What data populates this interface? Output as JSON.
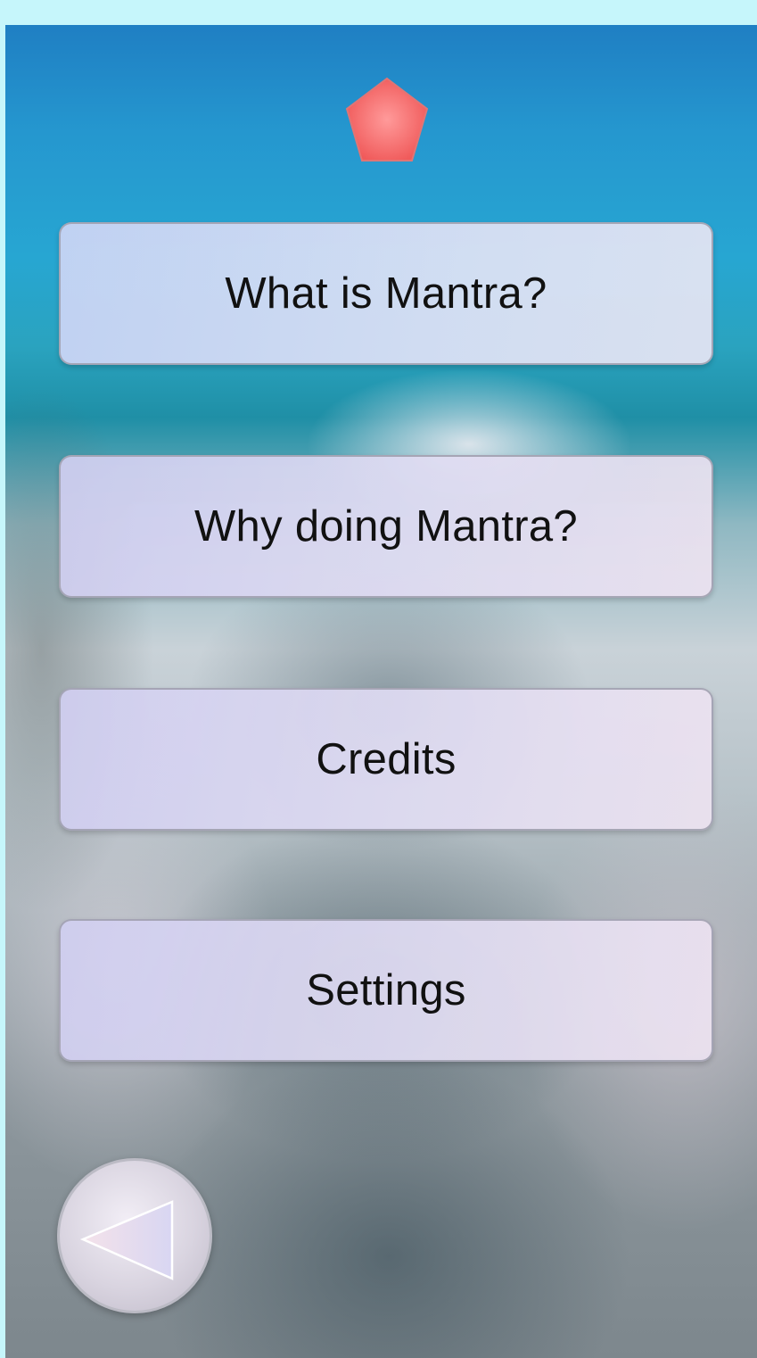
{
  "app": {
    "logo_icon": "pentagon-icon",
    "accent_color": "#f26a6a"
  },
  "menu": {
    "items": [
      {
        "label": "What is Mantra?"
      },
      {
        "label": "Why doing Mantra?"
      },
      {
        "label": "Credits"
      },
      {
        "label": "Settings"
      }
    ]
  },
  "navigation": {
    "back_icon": "back-triangle-icon"
  }
}
